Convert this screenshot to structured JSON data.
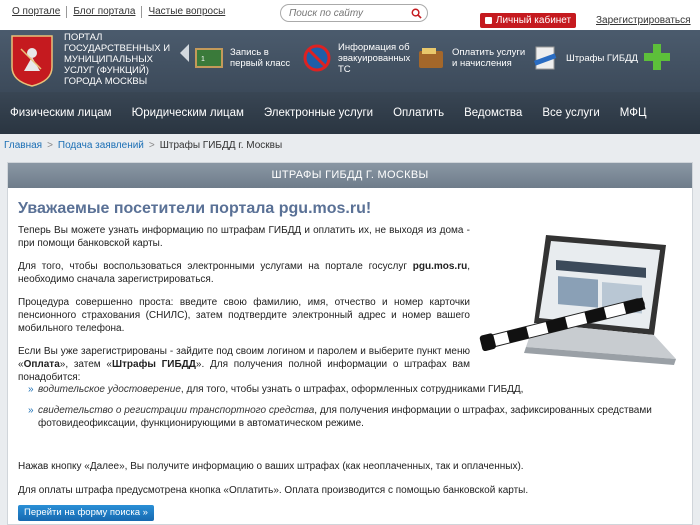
{
  "top": {
    "links": [
      "О портале",
      "Блог портала",
      "Частые вопросы"
    ],
    "search_placeholder": "Поиск по сайту",
    "cabinet_label": "Личный кабинет",
    "register_label": "Зарегистрироваться"
  },
  "header": {
    "portal_title": "Портал государственных и муниципальных услуг (функций) города Москвы",
    "services": [
      {
        "label": "Запись в первый класс",
        "icon": "school-board-icon"
      },
      {
        "label": "Информация об эвакуированных ТС",
        "icon": "no-parking-sign-icon"
      },
      {
        "label": "Оплатить услуги и начисления",
        "icon": "wallet-icon"
      },
      {
        "label": "Штрафы ГИБДД",
        "icon": "fine-document-icon"
      }
    ],
    "extra_icon": "medical-cross-icon"
  },
  "nav": [
    "Физическим лицам",
    "Юридическим лицам",
    "Электронные услуги",
    "Оплатить",
    "Ведомства",
    "Все услуги",
    "МФЦ"
  ],
  "breadcrumb": [
    "Главная",
    "Подача заявлений",
    "Штрафы ГИБДД г. Москвы"
  ],
  "page": {
    "header": "ШТРАФЫ ГИБДД Г. МОСКВЫ",
    "title": "Уважаемые посетители портала pgu.mos.ru!",
    "p1": "Теперь Вы можете узнать информацию по штрафам ГИБДД и оплатить их, не выходя из дома - при помощи банковской карты.",
    "p2_a": "Для того, чтобы воспользоваться электронными услугами на портале госуслуг ",
    "p2_b": "pgu.mos.ru",
    "p2_c": ", необходимо сначала зарегистрироваться.",
    "p3": "Процедура совершенно проста: введите свою фамилию, имя, отчество и номер карточки пенсионного страхования (СНИЛС), затем подтвердите электронный адрес и номер вашего мобильного телефона.",
    "p4_a": "Если Вы уже зарегистрированы - зайдите под своим логином и паролем и выберите пункт меню «",
    "p4_b": "Оплата",
    "p4_c": "», затем «",
    "p4_d": "Штрафы ГИБДД",
    "p4_e": "». Для получения полной информации о штрафах вам понадобится:",
    "b1_i": "водительское удостоверение",
    "b1_t": ", для того, чтобы узнать о штрафах, оформленных сотрудниками ГИБДД,",
    "b2_i": "свидетельство о регистрации транспортного средства",
    "b2_t": ", для получения информации о штрафах, зафиксированных средствами фотовидеофиксации, функционирующими в автоматическом режиме.",
    "p5": "Нажав кнопку «Далее», Вы получите информацию о ваших штрафах (как неоплаченных, так и оплаченных).",
    "p6": "Для оплаты штрафа предусмотрена кнопка «Оплатить». Оплата производится с помощью банковской карты.",
    "cta": "Перейти на форму поиска »"
  }
}
